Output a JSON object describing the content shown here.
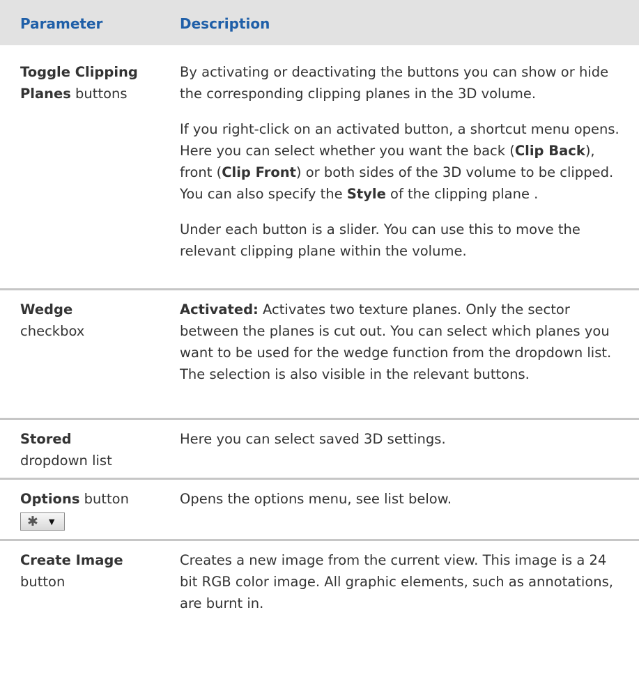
{
  "header": {
    "param": "Parameter",
    "desc": "Description"
  },
  "rows": [
    {
      "param_bold": "Toggle Clipping Planes",
      "param_rest": " buttons",
      "d1": "By activating or deactivating the buttons you can show or hide the corresponding clipping planes in the 3D volume.",
      "d2_a": "If you right-click on an activated button, a shortcut menu opens. Here you can select whether you want the back (",
      "d2_b": "Clip Back",
      "d2_c": "), front (",
      "d2_d": "Clip Front",
      "d2_e": ") or both sides of the 3D volume to be clipped. You can also specify the ",
      "d2_f": "Style",
      "d2_g": " of the clipping plane .",
      "d3": "Under each button is a slider. You can use this to move the relevant clipping plane within the volume."
    },
    {
      "param_bold": "Wedge",
      "param_rest": "checkbox",
      "d_bold": "Activated:",
      "d_rest": " Activates two texture planes. Only the sector between the planes is cut out. You can select which planes you want to be used for the wedge function from the dropdown list. The selection is also visible in the relevant buttons."
    },
    {
      "param_bold": "Stored",
      "param_rest": "dropdown list",
      "desc": "Here you can select saved 3D settings."
    },
    {
      "param_bold": "Options",
      "param_rest": " button",
      "icon": "gear-icon",
      "desc": "Opens the options menu, see list below."
    },
    {
      "param_bold": "Create Image",
      "param_rest": "button",
      "desc": "Creates a new image from the current view. This image is a 24 bit RGB color image. All graphic elements, such as annotations, are burnt in."
    }
  ]
}
